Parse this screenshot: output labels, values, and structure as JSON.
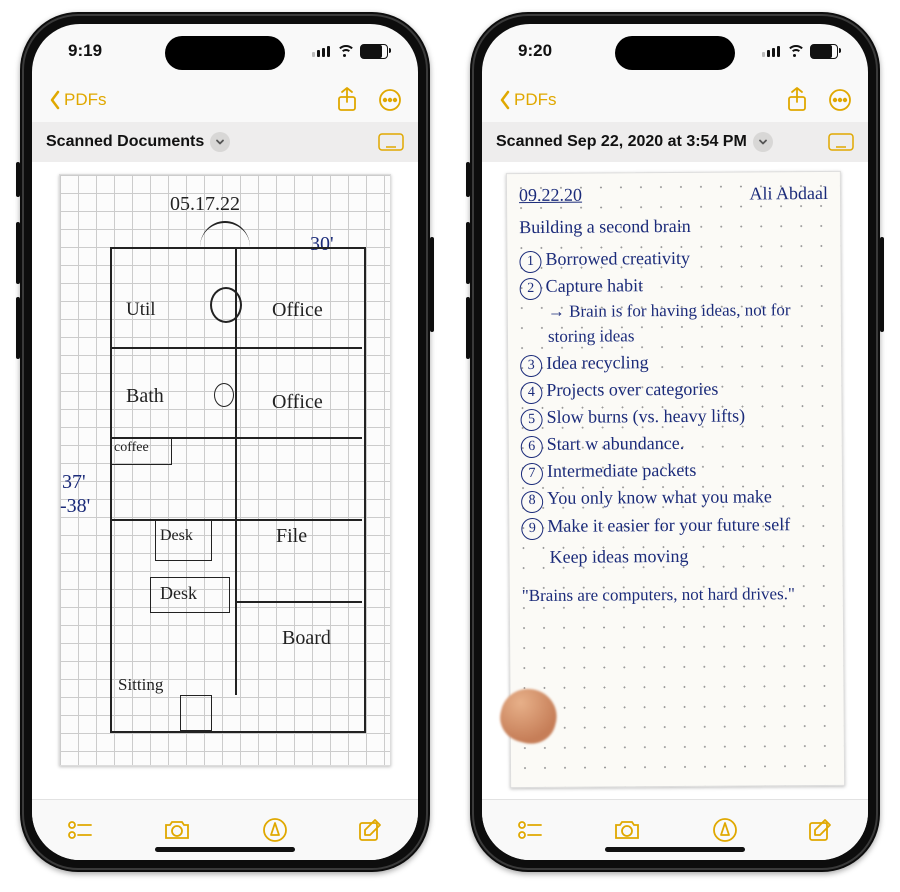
{
  "accent_color": "#e0a800",
  "phones": [
    {
      "status": {
        "time": "9:19"
      },
      "nav": {
        "back_label": "PDFs"
      },
      "note_title": "Scanned Documents",
      "scan": {
        "kind": "floor_plan_sketch",
        "date": "05.17.22",
        "dimensions": {
          "top": "30'",
          "left_top": "37'",
          "left_bottom": "-38'"
        },
        "rooms": [
          "Util",
          "Office",
          "Bath",
          "Office",
          "coffee",
          "Desk",
          "File",
          "Desk",
          "Board",
          "Sitting"
        ]
      }
    },
    {
      "status": {
        "time": "9:20"
      },
      "nav": {
        "back_label": "PDFs"
      },
      "note_title": "Scanned Sep 22, 2020 at 3:54 PM",
      "scan": {
        "kind": "handwritten_notes",
        "date": "09.22.20",
        "author": "Ali Abdaal",
        "title": "Building a second brain",
        "items": [
          "Borrowed creativity",
          "Capture habit",
          "Idea recycling",
          "Projects over categories",
          "Slow burns (vs. heavy lifts)",
          "Start w abundance.",
          "Intermediate packets",
          "You only know what you make",
          "Make it easier for your future self"
        ],
        "sub_note": "→ Brain is for having ideas, not for storing ideas",
        "closing": "Keep ideas moving",
        "quote": "\"Brains are computers, not hard drives.\""
      }
    }
  ]
}
